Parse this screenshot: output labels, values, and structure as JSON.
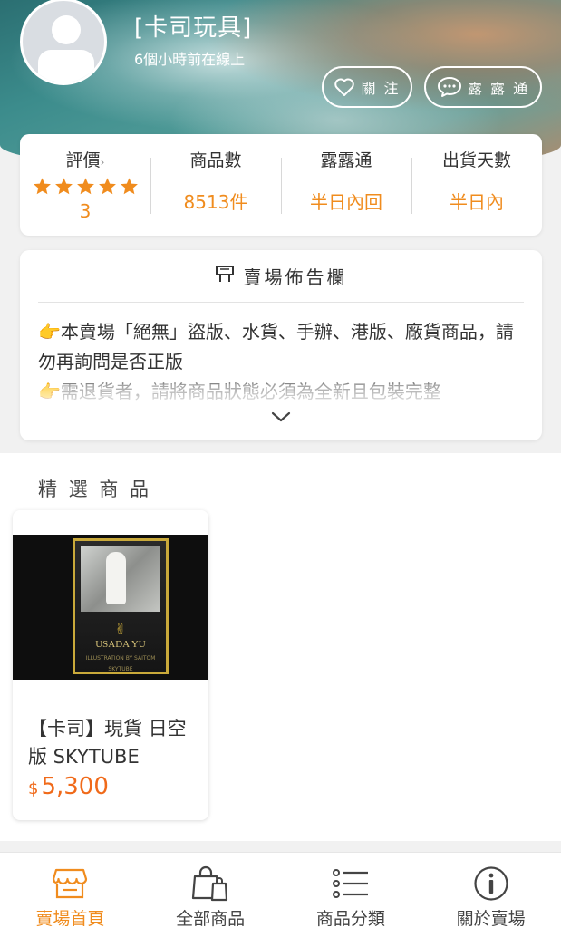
{
  "header": {
    "shop_name": "[卡司玩具]",
    "online_status": "6個小時前在線上",
    "follow_label": "關 注",
    "chat_label": "露 露 通"
  },
  "stats": {
    "rating_label": "評價",
    "rating_arrow": "›",
    "rating_stars": 5,
    "rating_value": "3",
    "products_label": "商品數",
    "products_value": "8513件",
    "chat_label": "露露通",
    "chat_value": "半日內回",
    "ship_label": "出貨天數",
    "ship_value": "半日內",
    "accent_color": "#f08c1e"
  },
  "notice": {
    "title": "賣場佈告欄",
    "emoji": "👉",
    "line1": "本賣場「絕無」盜版、水貨、手辦、港版、廠貨商品，請勿再詢問是否正版",
    "line2": "需退貨者，請將商品狀態必須為全新且包裝完整"
  },
  "featured": {
    "title": "精 選 商 品",
    "product": {
      "name": "【卡司】現貨 日空版 SKYTUBE",
      "currency": "$",
      "price": "5,300",
      "box_brand": "USADA YU",
      "box_small": "ILLUSTRATION BY SAITOM",
      "box_maker": "SKYTUBE"
    }
  },
  "bottom_nav": {
    "items": [
      {
        "label": "賣場首頁",
        "icon": "store-icon",
        "active": true
      },
      {
        "label": "全部商品",
        "icon": "shopping-bag-icon",
        "active": false
      },
      {
        "label": "商品分類",
        "icon": "list-icon",
        "active": false
      },
      {
        "label": "關於賣場",
        "icon": "info-icon",
        "active": false
      }
    ]
  }
}
